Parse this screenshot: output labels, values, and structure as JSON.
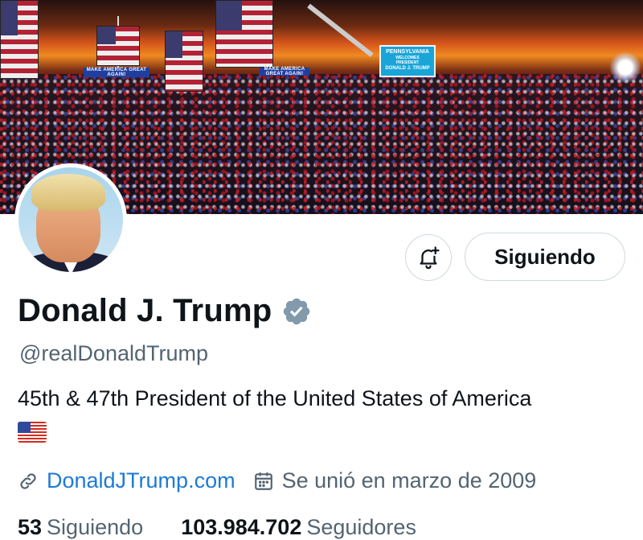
{
  "banner": {
    "sign_left": "MAKE AMERICA GREAT AGAIN!",
    "sign_center": "MAKE AMERICA GREAT AGAIN!",
    "screen_lines": [
      "PENNSYLVANIA",
      "WELCOMES",
      "PRESIDENT",
      "DONALD J. TRUMP"
    ]
  },
  "profile": {
    "display_name": "Donald J. Trump",
    "verified": true,
    "handle": "@realDonaldTrump",
    "bio": "45th & 47th President of the United States of America",
    "bio_emoji": "us-flag",
    "website": "DonaldJTrump.com",
    "joined": "Se unió en marzo de 2009"
  },
  "actions": {
    "follow_label": "Siguiendo",
    "bell_icon": "bell-plus-icon"
  },
  "stats": {
    "following_count": "53",
    "following_label": "Siguiendo",
    "followers_count": "103.984.702",
    "followers_label": "Seguidores"
  },
  "colors": {
    "link": "#1d7ad4",
    "verified_badge": "#829aab",
    "secondary_text": "#536471",
    "border": "#cfd9de"
  }
}
